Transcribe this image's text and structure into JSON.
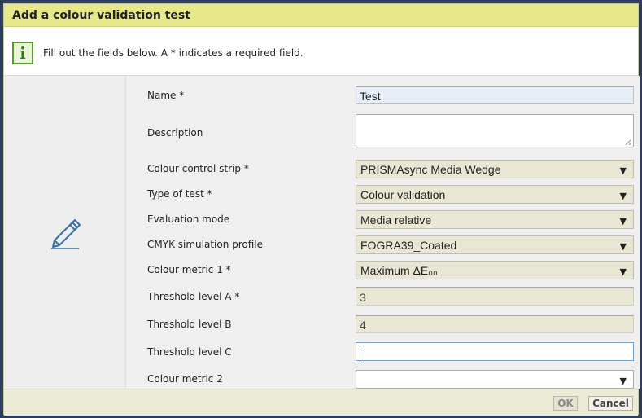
{
  "dialog": {
    "title": "Add a colour validation test",
    "info_text": "Fill out the fields below. A * indicates a required field.",
    "info_icon_glyph": "i"
  },
  "form": {
    "name_label": "Name *",
    "name_value": "Test",
    "description_label": "Description",
    "description_value": "",
    "strip_label": "Colour control strip *",
    "strip_value": "PRISMAsync Media Wedge",
    "type_label": "Type of test *",
    "type_value": "Colour validation",
    "eval_label": "Evaluation mode",
    "eval_value": "Media relative",
    "cmyk_label": "CMYK simulation profile",
    "cmyk_value": "FOGRA39_Coated",
    "metric1_label": "Colour metric 1 *",
    "metric1_value": "Maximum ΔE₀₀",
    "threshA_label": "Threshold level A *",
    "threshA_value": "3",
    "threshB_label": "Threshold level B",
    "threshB_value": "4",
    "threshC_label": "Threshold level C",
    "threshC_value": "",
    "metric2_label": "Colour metric 2",
    "metric2_value": "",
    "dropdown_arrow": "▼"
  },
  "footer": {
    "ok_label": "OK",
    "cancel_label": "Cancel"
  },
  "colors": {
    "title_bg": "#e6e88a",
    "footer_bg": "#ecebd6",
    "readonly_bg": "#e9e6d3"
  },
  "icons": {
    "info": "info-icon",
    "edit": "pencil-icon"
  }
}
